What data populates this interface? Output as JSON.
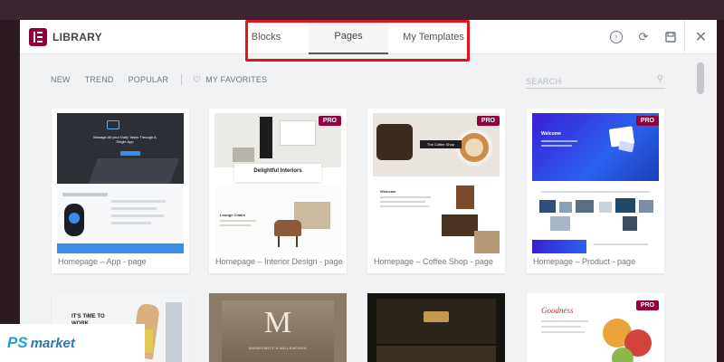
{
  "header": {
    "brand": "LIBRARY",
    "tabs": [
      {
        "label": "Blocks",
        "active": false
      },
      {
        "label": "Pages",
        "active": true
      },
      {
        "label": "My Templates",
        "active": false
      }
    ],
    "icons": [
      "upload-icon",
      "sync-icon",
      "save-icon",
      "close-icon"
    ],
    "close_glyph": "✕"
  },
  "toolbar": {
    "filters": [
      "NEW",
      "TREND",
      "POPULAR"
    ],
    "favorites": "MY FAVORITES",
    "search_placeholder": "SEARCH"
  },
  "pro_badge": "PRO",
  "colors": {
    "brand": "#92003b",
    "highlight": "#e0141e"
  },
  "templates": [
    {
      "title": "Homepage – App - page",
      "pro": false
    },
    {
      "title": "Homepage – Interior Design - page",
      "pro": true
    },
    {
      "title": "Homepage – Coffee Shop - page",
      "pro": true
    },
    {
      "title": "Homepage – Product - page",
      "pro": true
    }
  ],
  "previews": {
    "app_headline": "Manage All your Daily Tasks Through A Single App",
    "interior_headline": "Delightful Interiors",
    "interior_lounge": "Lounge Chairs",
    "coffee_banner": "The Coffee Shop",
    "coffee_welcome": "Welcome",
    "product_welcome": "Welcome",
    "row2_work": "IT'S TIME TO WORK",
    "row2_m": "M",
    "row2_firm": "MARKOWITZ & MILLENCASH",
    "row2_goodness": "Goodness"
  },
  "watermark": {
    "main": "PS",
    "sub": "market"
  }
}
